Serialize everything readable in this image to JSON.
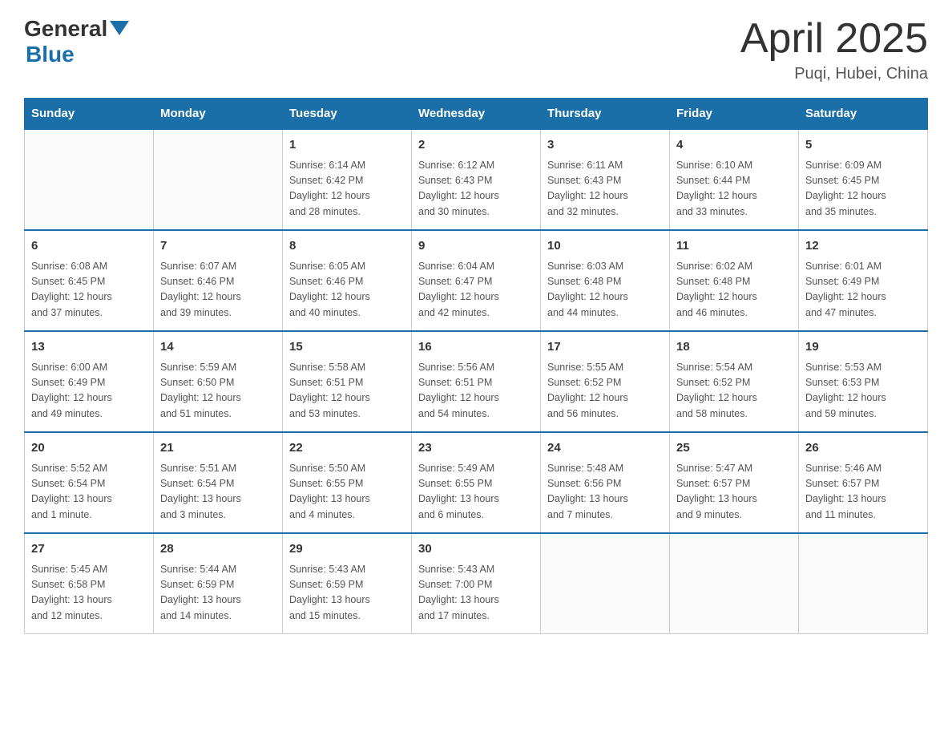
{
  "header": {
    "logo_general": "General",
    "logo_blue": "Blue",
    "title": "April 2025",
    "subtitle": "Puqi, Hubei, China"
  },
  "calendar": {
    "days_of_week": [
      "Sunday",
      "Monday",
      "Tuesday",
      "Wednesday",
      "Thursday",
      "Friday",
      "Saturday"
    ],
    "weeks": [
      [
        {
          "day": "",
          "info": ""
        },
        {
          "day": "",
          "info": ""
        },
        {
          "day": "1",
          "info": "Sunrise: 6:14 AM\nSunset: 6:42 PM\nDaylight: 12 hours\nand 28 minutes."
        },
        {
          "day": "2",
          "info": "Sunrise: 6:12 AM\nSunset: 6:43 PM\nDaylight: 12 hours\nand 30 minutes."
        },
        {
          "day": "3",
          "info": "Sunrise: 6:11 AM\nSunset: 6:43 PM\nDaylight: 12 hours\nand 32 minutes."
        },
        {
          "day": "4",
          "info": "Sunrise: 6:10 AM\nSunset: 6:44 PM\nDaylight: 12 hours\nand 33 minutes."
        },
        {
          "day": "5",
          "info": "Sunrise: 6:09 AM\nSunset: 6:45 PM\nDaylight: 12 hours\nand 35 minutes."
        }
      ],
      [
        {
          "day": "6",
          "info": "Sunrise: 6:08 AM\nSunset: 6:45 PM\nDaylight: 12 hours\nand 37 minutes."
        },
        {
          "day": "7",
          "info": "Sunrise: 6:07 AM\nSunset: 6:46 PM\nDaylight: 12 hours\nand 39 minutes."
        },
        {
          "day": "8",
          "info": "Sunrise: 6:05 AM\nSunset: 6:46 PM\nDaylight: 12 hours\nand 40 minutes."
        },
        {
          "day": "9",
          "info": "Sunrise: 6:04 AM\nSunset: 6:47 PM\nDaylight: 12 hours\nand 42 minutes."
        },
        {
          "day": "10",
          "info": "Sunrise: 6:03 AM\nSunset: 6:48 PM\nDaylight: 12 hours\nand 44 minutes."
        },
        {
          "day": "11",
          "info": "Sunrise: 6:02 AM\nSunset: 6:48 PM\nDaylight: 12 hours\nand 46 minutes."
        },
        {
          "day": "12",
          "info": "Sunrise: 6:01 AM\nSunset: 6:49 PM\nDaylight: 12 hours\nand 47 minutes."
        }
      ],
      [
        {
          "day": "13",
          "info": "Sunrise: 6:00 AM\nSunset: 6:49 PM\nDaylight: 12 hours\nand 49 minutes."
        },
        {
          "day": "14",
          "info": "Sunrise: 5:59 AM\nSunset: 6:50 PM\nDaylight: 12 hours\nand 51 minutes."
        },
        {
          "day": "15",
          "info": "Sunrise: 5:58 AM\nSunset: 6:51 PM\nDaylight: 12 hours\nand 53 minutes."
        },
        {
          "day": "16",
          "info": "Sunrise: 5:56 AM\nSunset: 6:51 PM\nDaylight: 12 hours\nand 54 minutes."
        },
        {
          "day": "17",
          "info": "Sunrise: 5:55 AM\nSunset: 6:52 PM\nDaylight: 12 hours\nand 56 minutes."
        },
        {
          "day": "18",
          "info": "Sunrise: 5:54 AM\nSunset: 6:52 PM\nDaylight: 12 hours\nand 58 minutes."
        },
        {
          "day": "19",
          "info": "Sunrise: 5:53 AM\nSunset: 6:53 PM\nDaylight: 12 hours\nand 59 minutes."
        }
      ],
      [
        {
          "day": "20",
          "info": "Sunrise: 5:52 AM\nSunset: 6:54 PM\nDaylight: 13 hours\nand 1 minute."
        },
        {
          "day": "21",
          "info": "Sunrise: 5:51 AM\nSunset: 6:54 PM\nDaylight: 13 hours\nand 3 minutes."
        },
        {
          "day": "22",
          "info": "Sunrise: 5:50 AM\nSunset: 6:55 PM\nDaylight: 13 hours\nand 4 minutes."
        },
        {
          "day": "23",
          "info": "Sunrise: 5:49 AM\nSunset: 6:55 PM\nDaylight: 13 hours\nand 6 minutes."
        },
        {
          "day": "24",
          "info": "Sunrise: 5:48 AM\nSunset: 6:56 PM\nDaylight: 13 hours\nand 7 minutes."
        },
        {
          "day": "25",
          "info": "Sunrise: 5:47 AM\nSunset: 6:57 PM\nDaylight: 13 hours\nand 9 minutes."
        },
        {
          "day": "26",
          "info": "Sunrise: 5:46 AM\nSunset: 6:57 PM\nDaylight: 13 hours\nand 11 minutes."
        }
      ],
      [
        {
          "day": "27",
          "info": "Sunrise: 5:45 AM\nSunset: 6:58 PM\nDaylight: 13 hours\nand 12 minutes."
        },
        {
          "day": "28",
          "info": "Sunrise: 5:44 AM\nSunset: 6:59 PM\nDaylight: 13 hours\nand 14 minutes."
        },
        {
          "day": "29",
          "info": "Sunrise: 5:43 AM\nSunset: 6:59 PM\nDaylight: 13 hours\nand 15 minutes."
        },
        {
          "day": "30",
          "info": "Sunrise: 5:43 AM\nSunset: 7:00 PM\nDaylight: 13 hours\nand 17 minutes."
        },
        {
          "day": "",
          "info": ""
        },
        {
          "day": "",
          "info": ""
        },
        {
          "day": "",
          "info": ""
        }
      ]
    ]
  }
}
